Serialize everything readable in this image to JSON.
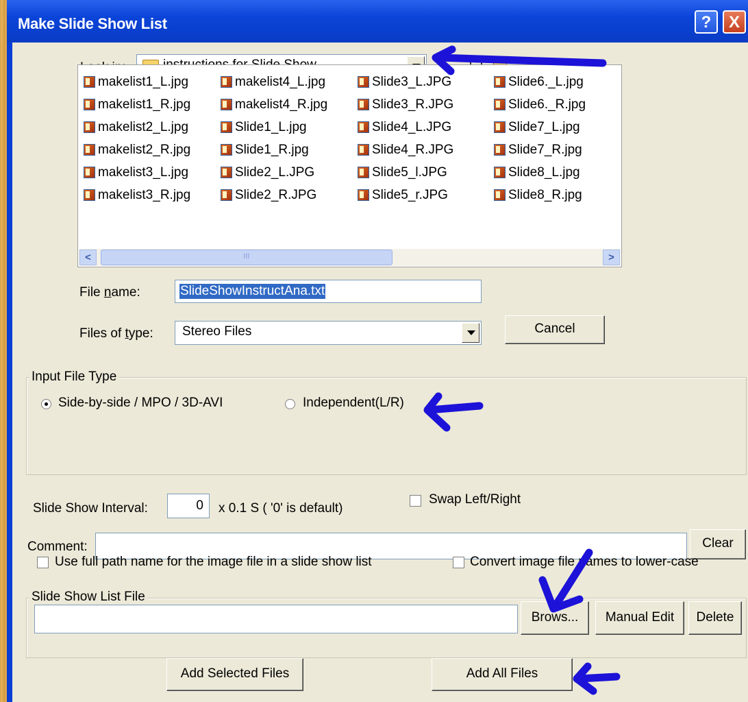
{
  "window": {
    "title": "Make Slide Show List",
    "help_icon": "?",
    "close_icon": "X"
  },
  "lookin": {
    "label_pre": "Look ",
    "label_u": "i",
    "label_post": "n:",
    "value": "instructions for Slide Show"
  },
  "files": {
    "col1": [
      "makelist1_L.jpg",
      "makelist1_R.jpg",
      "makelist2_L.jpg",
      "makelist2_R.jpg",
      "makelist3_L.jpg",
      "makelist3_R.jpg"
    ],
    "col2": [
      "makelist4_L.jpg",
      "makelist4_R.jpg",
      "Slide1_L.jpg",
      "Slide1_R.jpg",
      "Slide2_L.JPG",
      "Slide2_R.JPG"
    ],
    "col3": [
      "Slide3_L.JPG",
      "Slide3_R.JPG",
      "Slide4_L.JPG",
      "Slide4_R.JPG",
      "Slide5_l.JPG",
      "Slide5_r.JPG"
    ],
    "col4": [
      "Slide6._L.jpg",
      "Slide6._R.jpg",
      "Slide7_L.jpg",
      "Slide7_R.jpg",
      "Slide8_L.jpg",
      "Slide8_R.jpg"
    ],
    "scroll_left": "<",
    "scroll_right": ">",
    "thumb_grip": "III"
  },
  "filename": {
    "label_pre": "File ",
    "label_u": "n",
    "label_post": "ame:",
    "value": "SlideShowInstructAna.txt"
  },
  "filetype": {
    "label_pre": "Files of ",
    "label_u": "t",
    "label_post": "ype:",
    "value": "Stereo Files",
    "cancel": "Cancel"
  },
  "input_type": {
    "title": "Input File Type",
    "opt1": "Side-by-side / MPO / 3D-AVI",
    "opt2": "Independent(L/R)",
    "selected": "opt1"
  },
  "interval": {
    "label": "Slide Show Interval:",
    "value": "0",
    "suffix": "x 0.1 S ( '0' is default)",
    "swap_label": "Swap Left/Right"
  },
  "comment": {
    "label": "Comment:",
    "value": "",
    "clear": "Clear"
  },
  "options": {
    "full_path": "Use full path name for the image file in a slide show list",
    "lower_case": "Convert image file names to lower-case"
  },
  "list_file": {
    "title": "Slide Show List File",
    "value": "",
    "browse": "Brows...",
    "manual_edit": "Manual Edit",
    "delete": "Delete"
  },
  "actions": {
    "add_selected": "Add Selected Files",
    "add_all": "Add All Files"
  },
  "colors": {
    "annotation": "#1c12d8",
    "titlebar": "#0b44d8",
    "dialog": "#ece9d8",
    "selection": "#316ac5"
  }
}
